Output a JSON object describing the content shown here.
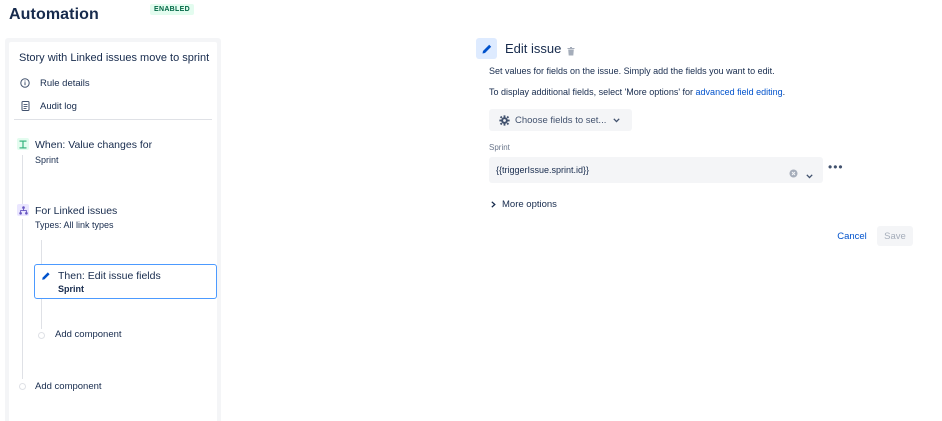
{
  "app": {
    "title": "Automation",
    "status_badge": "ENABLED"
  },
  "sidebar": {
    "rule_name": "Story with Linked issues move to sprint",
    "nav": [
      {
        "label": "Rule details",
        "icon": "info-icon"
      },
      {
        "label": "Audit log",
        "icon": "document-icon"
      }
    ],
    "steps": [
      {
        "title": "When: Value changes for",
        "subtitle": "Sprint",
        "icon": "trigger-icon",
        "color": "#36b37e"
      },
      {
        "title": "For Linked issues",
        "subtitle": "Types: All link types",
        "icon": "branch-icon",
        "color": "#6554c0"
      },
      {
        "title": "Then: Edit issue fields",
        "subtitle": "Sprint",
        "icon": "pencil-icon",
        "color": "#0052cc"
      }
    ],
    "add_component_inner": "Add component",
    "add_component_outer": "Add component"
  },
  "panel": {
    "title": "Edit issue",
    "description_1": "Set values for fields on the issue. Simply add the fields you want to edit.",
    "description_2_prefix": "To display additional fields, select 'More options' for ",
    "description_2_link": "advanced field editing",
    "description_2_suffix": ".",
    "choose_fields_label": "Choose fields to set...",
    "field": {
      "label": "Sprint",
      "value": "{{triggerIssue.sprint.id}}"
    },
    "more_options_label": "More options",
    "cancel_label": "Cancel",
    "save_label": "Save"
  },
  "colors": {
    "accent": "#0052cc",
    "selected_border": "#4c9aff",
    "enabled_bg": "#e3fcef",
    "enabled_text": "#006644"
  }
}
